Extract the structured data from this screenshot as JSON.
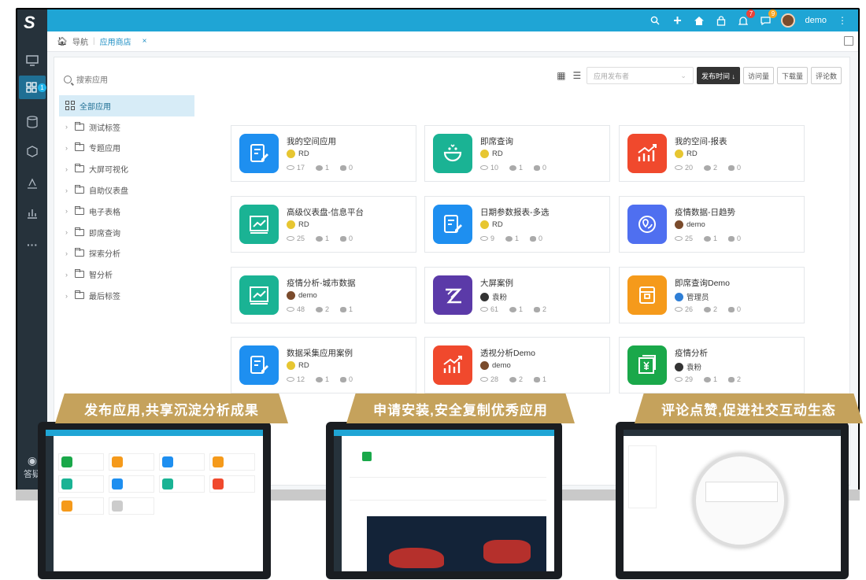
{
  "sidebar": {
    "logo": "S",
    "badge": "1",
    "bottom_label": "答疑"
  },
  "topbar": {
    "user": "demo",
    "bell_badge": "7",
    "chat_badge": "9",
    "icons": [
      "search-icon",
      "plus-icon",
      "home-icon",
      "lock-icon",
      "bell-icon",
      "chat-icon",
      "avatar",
      "more-icon"
    ]
  },
  "breadcrumb": {
    "home": "导航",
    "current": "应用商店",
    "close": "×"
  },
  "search": {
    "placeholder": "搜索应用"
  },
  "tree": {
    "root": "全部应用",
    "items": [
      "测试标签",
      "专题应用",
      "大屏可视化",
      "自助仪表盘",
      "电子表格",
      "即席查询",
      "探索分析",
      "智分析",
      "最后标签"
    ]
  },
  "toolbar": {
    "select_placeholder": "应用发布者",
    "sort_buttons": [
      "发布时间 ↓",
      "访问量",
      "下载量",
      "评论数"
    ]
  },
  "cards": [
    {
      "title": "我的空间应用",
      "author": "RD",
      "views": "17",
      "likes": "1",
      "comments": "0",
      "color": "#1e8ff0",
      "icon": "report-edit-icon",
      "avatar": "yellow"
    },
    {
      "title": "即席查询",
      "author": "RD",
      "views": "10",
      "likes": "1",
      "comments": "0",
      "color": "#1ab394",
      "icon": "query-face-icon",
      "avatar": "yellow"
    },
    {
      "title": "我的空间-报表",
      "author": "RD",
      "views": "20",
      "likes": "2",
      "comments": "0",
      "color": "#f0492d",
      "icon": "chart-growth-icon",
      "avatar": "yellow"
    },
    {
      "title": "高级仪表盘-信息平台",
      "author": "RD",
      "views": "25",
      "likes": "1",
      "comments": "0",
      "color": "#1ab394",
      "icon": "dashboard-icon",
      "avatar": "yellow"
    },
    {
      "title": "日期参数报表-多选",
      "author": "RD",
      "views": "9",
      "likes": "1",
      "comments": "0",
      "color": "#1e8ff0",
      "icon": "report-edit-icon",
      "avatar": "yellow"
    },
    {
      "title": "疫情数据-日趋势",
      "author": "demo",
      "views": "25",
      "likes": "1",
      "comments": "0",
      "color": "#4f6ff0",
      "icon": "map-pin-icon",
      "avatar": "photo"
    },
    {
      "title": "疫情分析-城市数据",
      "author": "demo",
      "views": "48",
      "likes": "2",
      "comments": "1",
      "color": "#1ab394",
      "icon": "dashboard-icon",
      "avatar": "photo"
    },
    {
      "title": "大屏案例",
      "author": "袁粉",
      "views": "61",
      "likes": "1",
      "comments": "2",
      "color": "#5b3aa8",
      "icon": "bigscreen-icon",
      "avatar": "girl"
    },
    {
      "title": "即席查询Demo",
      "author": "管理员",
      "views": "26",
      "likes": "2",
      "comments": "0",
      "color": "#f59a1b",
      "icon": "calendar-icon",
      "avatar": "blue"
    },
    {
      "title": "数据采集应用案例",
      "author": "RD",
      "views": "12",
      "likes": "1",
      "comments": "0",
      "color": "#1e8ff0",
      "icon": "report-edit-icon",
      "avatar": "yellow"
    },
    {
      "title": "透视分析Demo",
      "author": "demo",
      "views": "28",
      "likes": "2",
      "comments": "1",
      "color": "#f0492d",
      "icon": "chart-growth-icon",
      "avatar": "photo"
    },
    {
      "title": "疫情分析",
      "author": "袁粉",
      "views": "29",
      "likes": "1",
      "comments": "2",
      "color": "#1aa84a",
      "icon": "yuan-doc-icon",
      "avatar": "girl"
    }
  ],
  "promos": [
    {
      "text": "发布应用,共享沉淀分析成果"
    },
    {
      "text": "申请安装,安全复制优秀应用"
    },
    {
      "text": "评论点赞,促进社交互动生态"
    }
  ],
  "colors": {
    "topbar": "#1fa5d5",
    "sidebar": "#26323b",
    "promo": "#c5a25c"
  }
}
